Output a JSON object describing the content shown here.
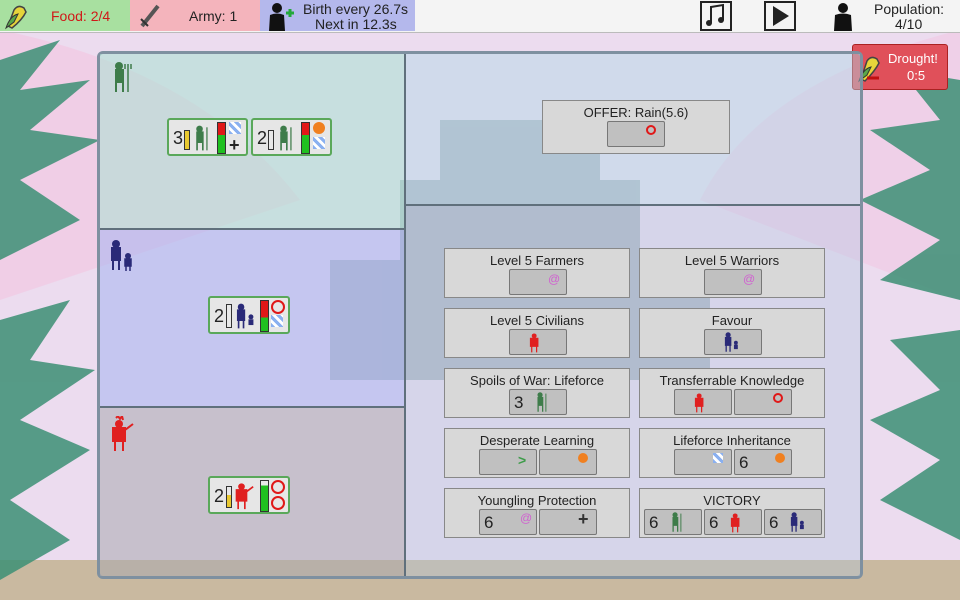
{
  "topbar": {
    "food": "Food: 2/4",
    "army": "Army: 1",
    "birth_line1": "Birth every 26.7s",
    "birth_line2": "Next in 12.3s",
    "population_label": "Population:",
    "population_value": "4/10",
    "icons": [
      "corn-icon",
      "sword-icon",
      "person-plus-icon",
      "music-note-icon",
      "play-icon",
      "person-icon"
    ]
  },
  "drought": {
    "title": "Drought!",
    "value": "0:5"
  },
  "lanes": [
    {
      "name": "farmers",
      "units": [
        {
          "count": "3"
        },
        {
          "count": "2"
        }
      ]
    },
    {
      "name": "civilians",
      "units": [
        {
          "count": "2"
        }
      ]
    },
    {
      "name": "warriors",
      "units": [
        {
          "count": "2"
        }
      ]
    }
  ],
  "offer": {
    "title": "OFFER: Rain(5.6)"
  },
  "rituals": [
    {
      "title": "Level 5 Farmers"
    },
    {
      "title": "Level 5 Warriors"
    },
    {
      "title": "Level 5 Civilians"
    },
    {
      "title": "Favour"
    },
    {
      "title": "Spoils of War: Lifeforce",
      "slot_num": "3"
    },
    {
      "title": "Transferrable Knowledge"
    },
    {
      "title": "Desperate Learning"
    },
    {
      "title": "Lifeforce Inheritance",
      "slot_num": "6"
    },
    {
      "title": "Youngling Protection",
      "slot_num": "6"
    },
    {
      "title": "VICTORY",
      "nums": [
        "6",
        "6",
        "6"
      ]
    }
  ],
  "colors": {
    "farmer": "#3e7c4a",
    "warrior": "#e02020",
    "civilian": "#2a2a78",
    "food_bg": "#a8e0a0",
    "army_bg": "#f4b4bc",
    "birth_bg": "#b4b8ec",
    "drought_bg": "#e0505a"
  }
}
